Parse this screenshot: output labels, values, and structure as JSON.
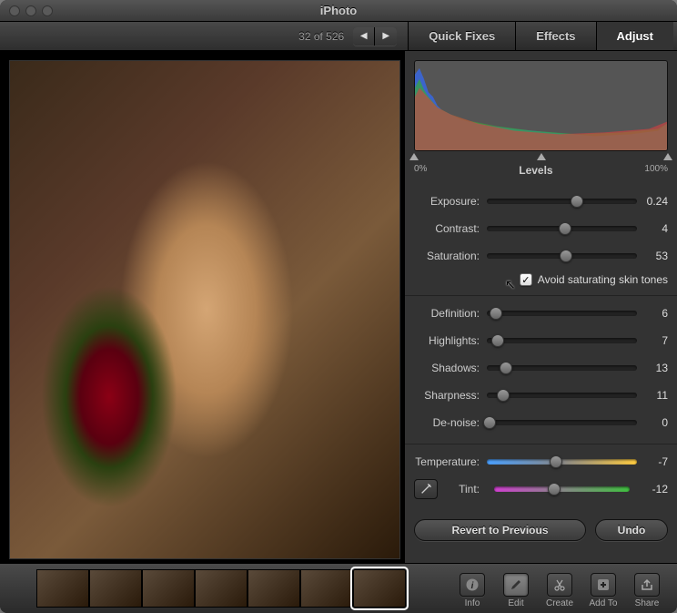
{
  "title": "iPhoto",
  "counter": "32 of 526",
  "tabs": {
    "quick_fixes": "Quick Fixes",
    "effects": "Effects",
    "adjust": "Adjust"
  },
  "levels": {
    "label": "Levels",
    "min": "0%",
    "max": "100%"
  },
  "sliders": {
    "exposure": {
      "label": "Exposure:",
      "value": "0.24",
      "pos": 60
    },
    "contrast": {
      "label": "Contrast:",
      "value": "4",
      "pos": 52
    },
    "saturation": {
      "label": "Saturation:",
      "value": "53",
      "pos": 53
    },
    "definition": {
      "label": "Definition:",
      "value": "6",
      "pos": 6
    },
    "highlights": {
      "label": "Highlights:",
      "value": "7",
      "pos": 7
    },
    "shadows": {
      "label": "Shadows:",
      "value": "13",
      "pos": 13
    },
    "sharpness": {
      "label": "Sharpness:",
      "value": "11",
      "pos": 11
    },
    "denoise": {
      "label": "De-noise:",
      "value": "0",
      "pos": 2
    },
    "temperature": {
      "label": "Temperature:",
      "value": "-7",
      "pos": 46
    },
    "tint": {
      "label": "Tint:",
      "value": "-12",
      "pos": 44
    }
  },
  "checkbox": {
    "label": "Avoid saturating skin tones",
    "checked": true
  },
  "buttons": {
    "revert": "Revert to Previous",
    "undo": "Undo"
  },
  "footer": {
    "info": "Info",
    "edit": "Edit",
    "create": "Create",
    "addto": "Add To",
    "share": "Share"
  }
}
